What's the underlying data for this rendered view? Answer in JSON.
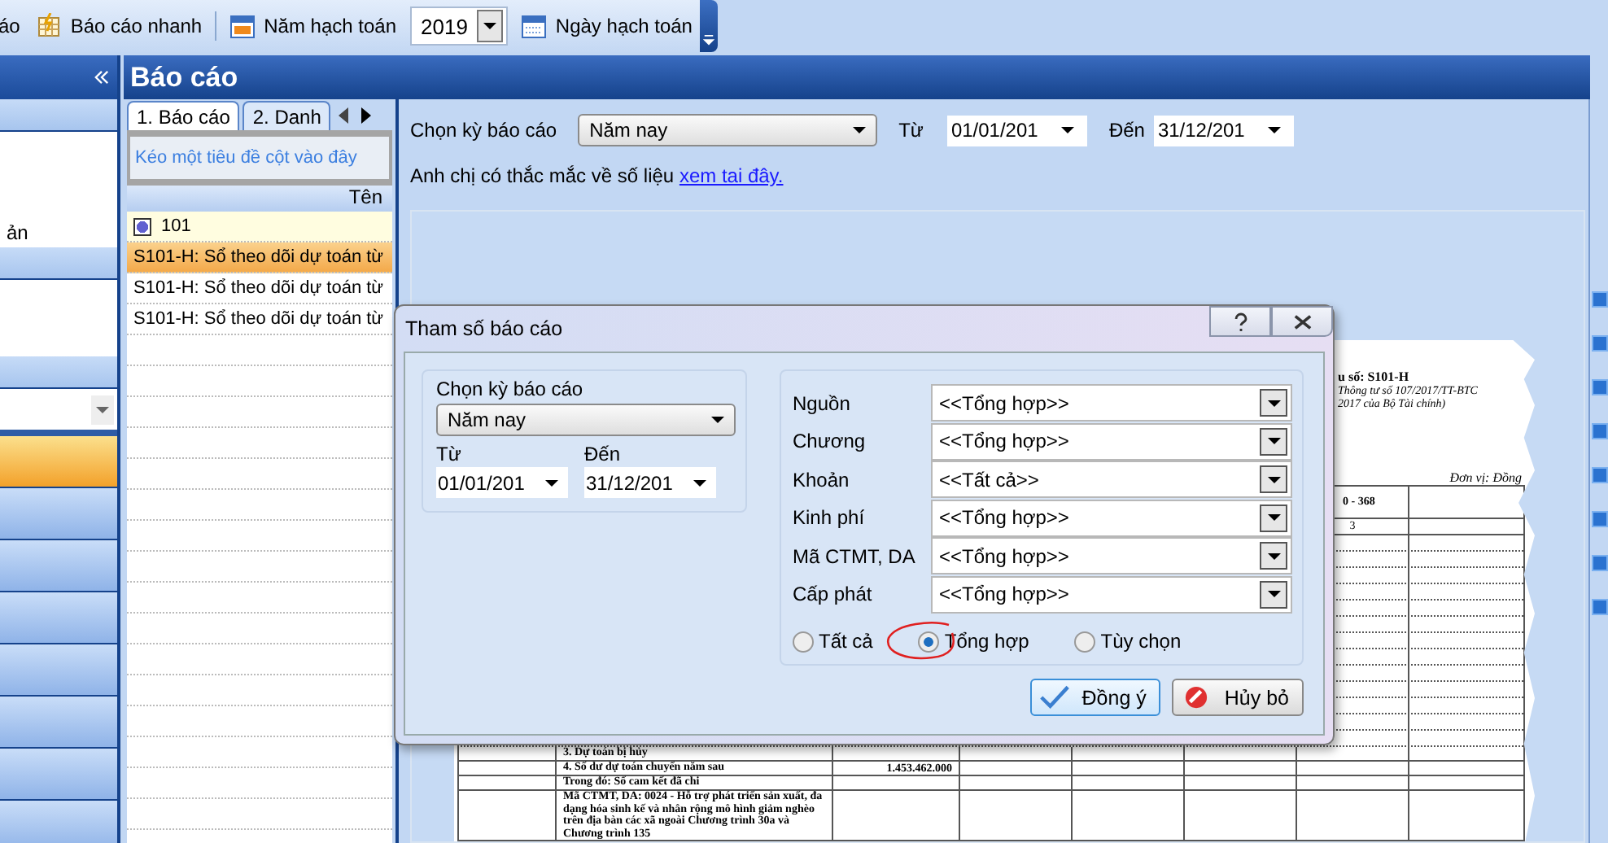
{
  "toolbar": {
    "items": [
      {
        "kind": "cut",
        "label": "áo"
      },
      {
        "kind": "quick",
        "label": "Báo cáo nhanh"
      },
      {
        "kind": "year-label",
        "label": "Năm hạch toán"
      },
      {
        "kind": "year-select",
        "value": "2019"
      },
      {
        "kind": "date",
        "label": "Ngày hạch toán"
      }
    ]
  },
  "sidebar": {
    "partial_label": "ản",
    "nav_items": [
      {
        "selected": true
      },
      {
        "selected": false
      },
      {
        "selected": false
      },
      {
        "selected": false
      },
      {
        "selected": false
      },
      {
        "selected": false
      },
      {
        "selected": false
      },
      {
        "selected": false
      }
    ]
  },
  "panel": {
    "title": "Báo cáo",
    "tabs": [
      {
        "label": "1. Báo cáo",
        "selected": true
      },
      {
        "label": "2. Danh",
        "selected": false
      }
    ],
    "group_hint": "Kéo một tiêu đề cột vào đây",
    "column": "Tên",
    "group_row": "101",
    "rows": [
      {
        "label": "S101-H: Sổ theo dõi dự toán từ",
        "selected": true
      },
      {
        "label": "S101-H: Sổ theo dõi dự toán từ",
        "selected": false
      },
      {
        "label": "S101-H: Sổ theo dõi dự toán từ",
        "selected": false
      }
    ]
  },
  "filter": {
    "period_label": "Chọn kỳ báo cáo",
    "period": "Năm nay",
    "from_label": "Từ",
    "from": "01/01/201",
    "to_label": "Đến",
    "to": "31/12/201"
  },
  "help": {
    "text": "Anh chị có thắc mắc về số liệu",
    "link": "xem tai đây."
  },
  "preview": {
    "form_no": "u số: S101-H",
    "circular": [
      "Thông tư số 107/2017/TT-BTC",
      "2017 của Bộ Tài chính)"
    ],
    "unit": "Đơn vị: Đồng",
    "header_cell": "0 - 368",
    "index_cell": "3",
    "rows": [
      {
        "label": "3. Dự toán bị hủy",
        "amount": null
      },
      {
        "label": "4. Số dư dự toán chuyển năm sau",
        "amount": "1.453.462.000"
      },
      {
        "label": "Trong đó: Số cam kết đã chi",
        "amount": null
      },
      {
        "label": "Mã CTMT, DA: 0024 - Hỗ trợ phát triển sản xuất, đa dạng hóa sinh kế và nhân rộng mô hình giảm nghèo trên địa bàn các xã ngoài Chương trình 30a và Chương trình 135",
        "amount": null
      }
    ]
  },
  "dialog": {
    "title": "Tham số báo cáo",
    "period_label": "Chọn kỳ báo cáo",
    "period": "Năm nay",
    "from_label": "Từ",
    "from": "01/01/201",
    "to_label": "Đến",
    "to": "31/12/201",
    "fields": [
      {
        "label": "Nguồn",
        "value": "<<Tổng hợp>>"
      },
      {
        "label": "Chương",
        "value": "<<Tổng hợp>>"
      },
      {
        "label": "Khoản",
        "value": "<<Tất cả>>"
      },
      {
        "label": "Kinh phí",
        "value": "<<Tổng hợp>>"
      },
      {
        "label": "Mã CTMT, DA",
        "value": "<<Tổng hợp>>"
      },
      {
        "label": "Cấp phát",
        "value": "<<Tổng hợp>>"
      }
    ],
    "options": [
      {
        "label": "Tất cả",
        "selected": false
      },
      {
        "label": "Tổng hợp",
        "selected": true
      },
      {
        "label": "Tùy chọn",
        "selected": false
      }
    ],
    "buttons": [
      {
        "kind": "ok",
        "label": "Đồng ý"
      },
      {
        "kind": "cancel",
        "label": "Hủy bỏ"
      }
    ]
  }
}
